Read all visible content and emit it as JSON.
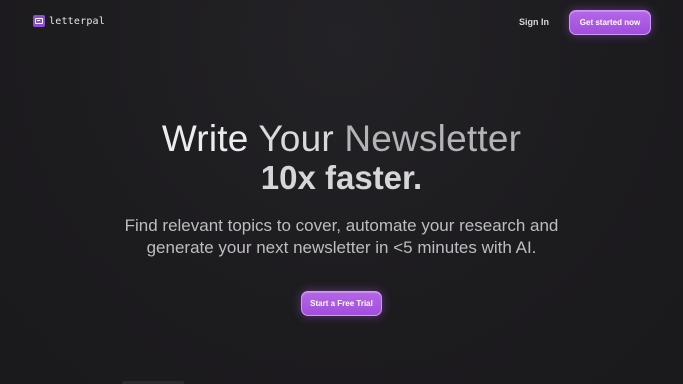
{
  "brand": {
    "name": "letterpal",
    "icon": "letter-icon",
    "accent_color": "#a655e0"
  },
  "nav": {
    "signin_label": "Sign In",
    "cta_label": "Get started now"
  },
  "hero": {
    "headline_words": [
      "Write",
      "Your",
      "Newsletter"
    ],
    "headline_line2": "10x faster.",
    "subtitle_line1": "Find relevant topics to cover, automate your research and",
    "subtitle_line2": "generate your next newsletter in <5 minutes with AI.",
    "cta_label": "Start a Free Trial"
  }
}
